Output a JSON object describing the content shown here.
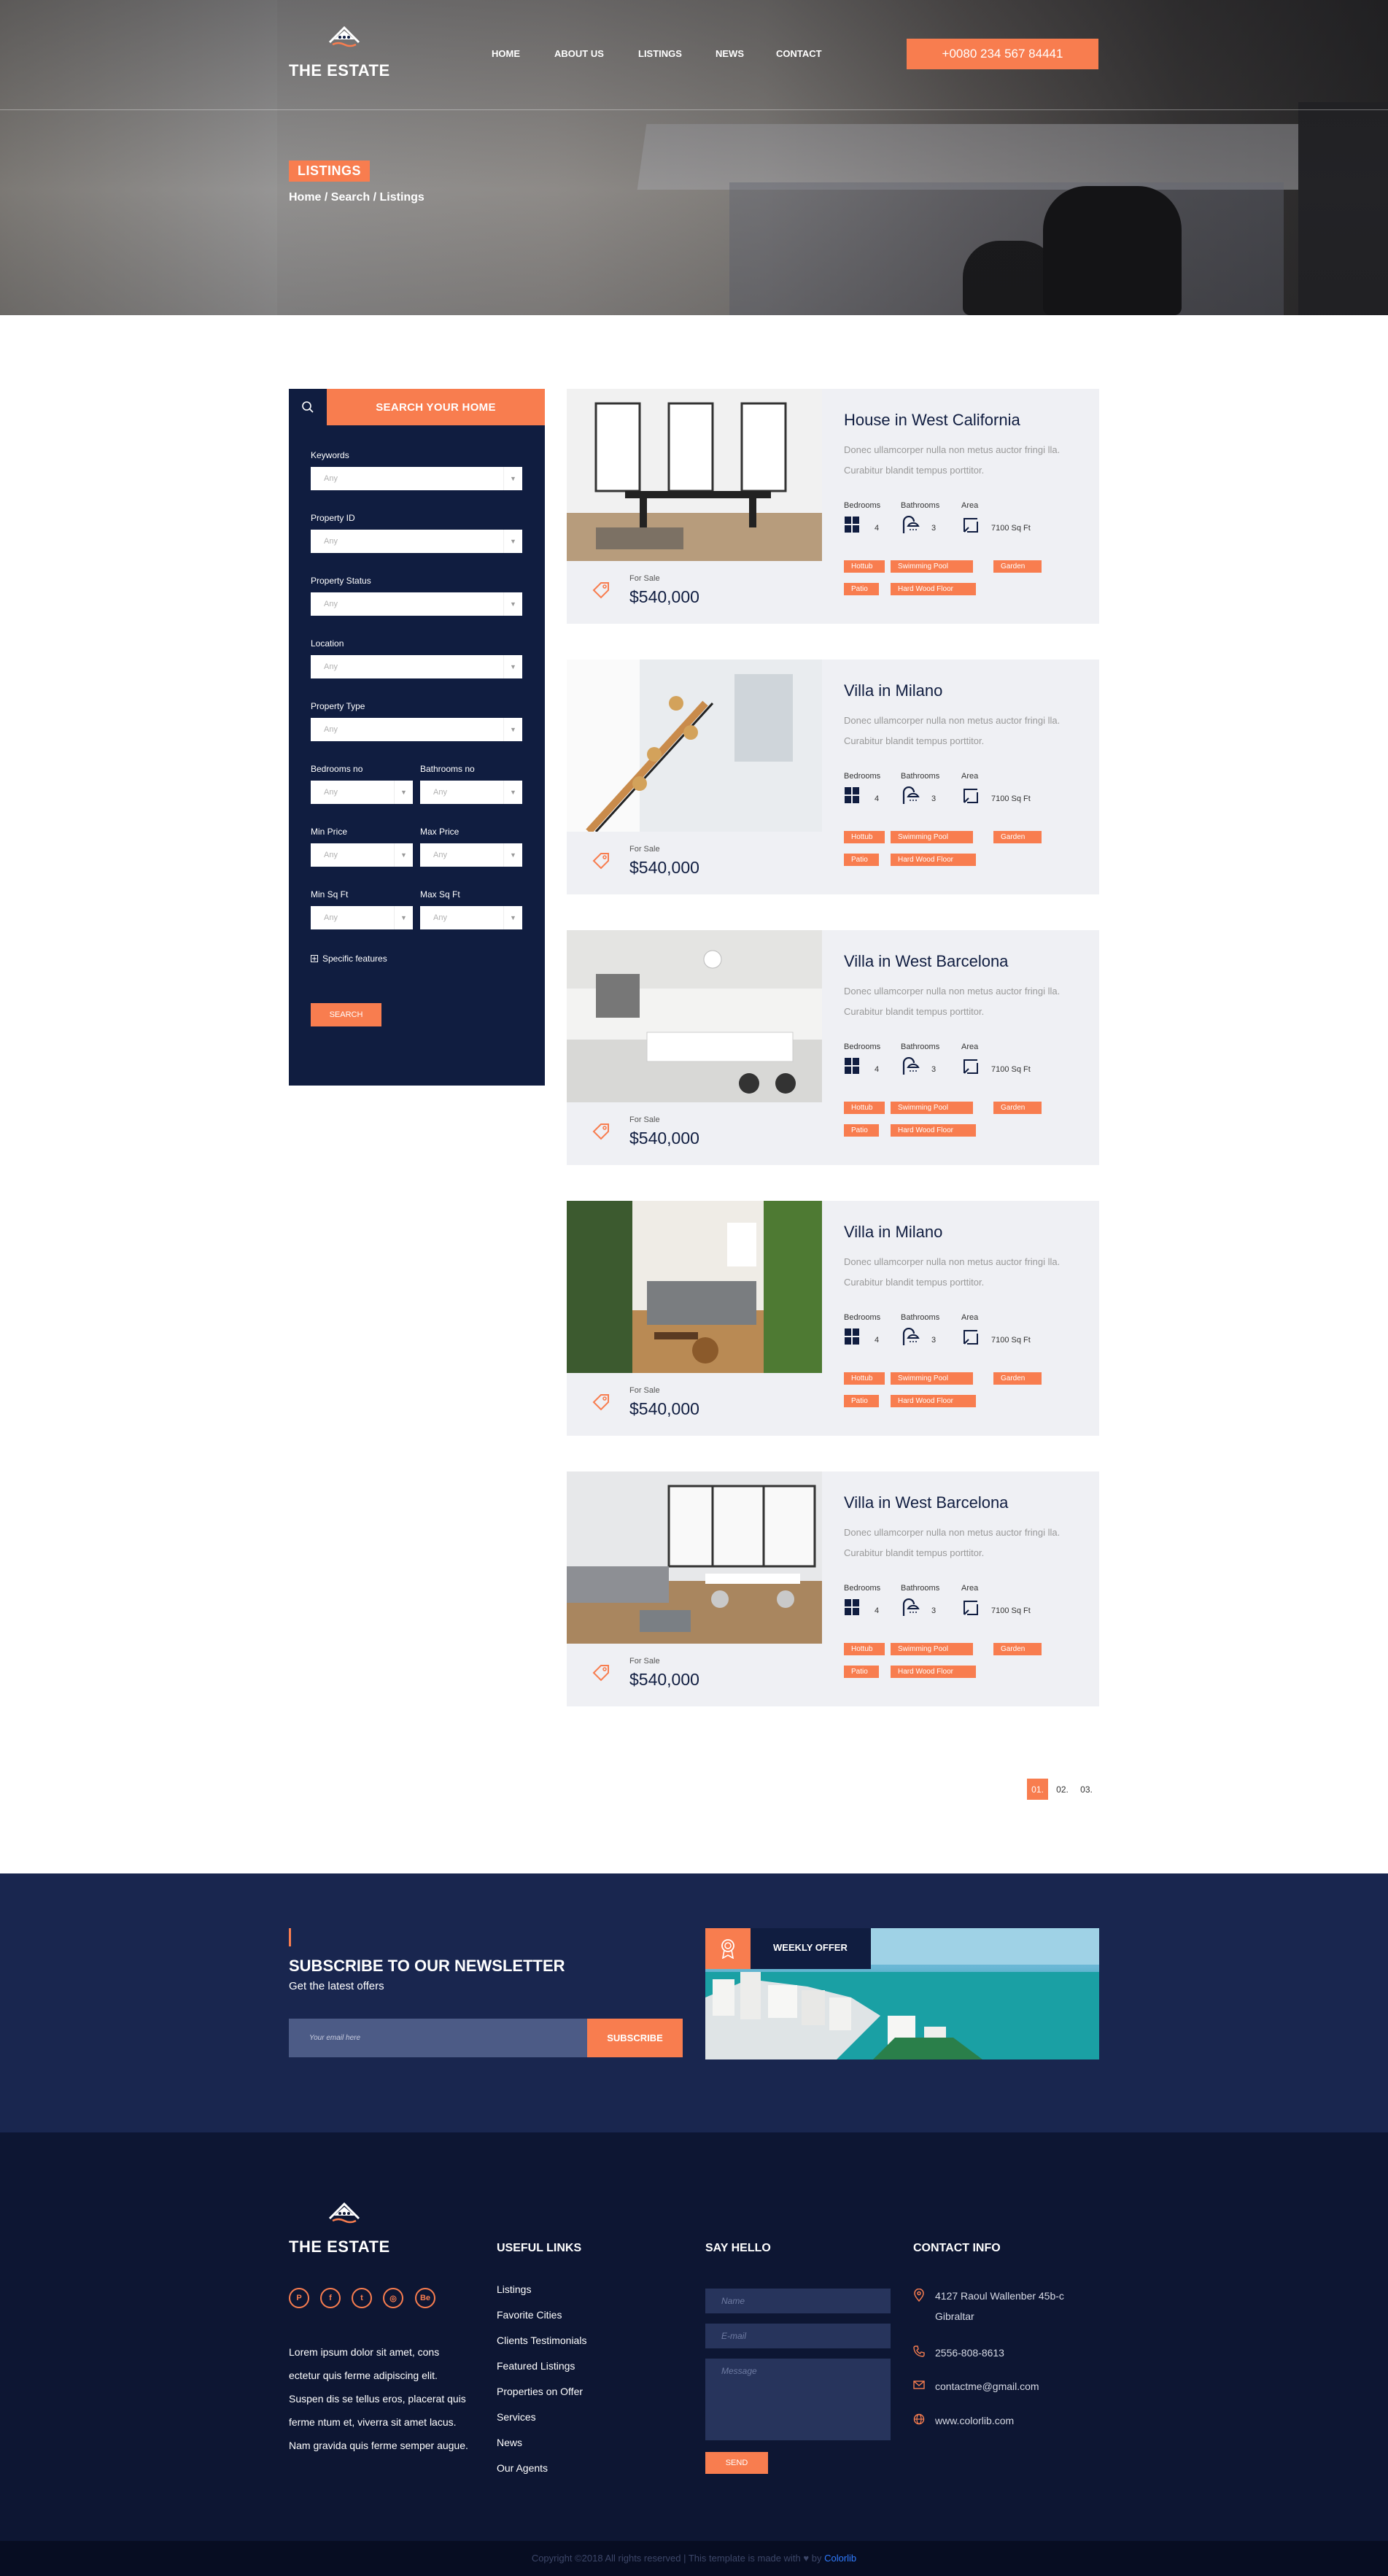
{
  "header": {
    "logo_text": "THE ESTATE",
    "nav": [
      "HOME",
      "ABOUT US",
      "LISTINGS",
      "NEWS",
      "CONTACT"
    ],
    "phone": "+0080 234 567 84441"
  },
  "hero": {
    "page_title": "LISTINGS",
    "breadcrumb": "Home / Search / Listings"
  },
  "search": {
    "title": "SEARCH YOUR HOME",
    "fields": {
      "keywords": {
        "label": "Keywords",
        "value": "Any"
      },
      "property_id": {
        "label": "Property ID",
        "value": "Any"
      },
      "property_status": {
        "label": "Property Status",
        "value": "Any"
      },
      "location": {
        "label": "Location",
        "value": "Any"
      },
      "property_type": {
        "label": "Property Type",
        "value": "Any"
      },
      "bedrooms": {
        "label": "Bedrooms no",
        "value": "Any"
      },
      "bathrooms": {
        "label": "Bathrooms no",
        "value": "Any"
      },
      "min_price": {
        "label": "Min Price",
        "value": "Any"
      },
      "max_price": {
        "label": "Max Price",
        "value": "Any"
      },
      "min_sqft": {
        "label": "Min Sq Ft",
        "value": "Any"
      },
      "max_sqft": {
        "label": "Max Sq Ft",
        "value": "Any"
      }
    },
    "specific_features": "Specific features",
    "button": "SEARCH"
  },
  "listing_labels": {
    "bedrooms": "Bedrooms",
    "bathrooms": "Bathrooms",
    "area": "Area"
  },
  "listings": [
    {
      "title": "House in West California",
      "desc": "Donec ullamcorper nulla non metus auctor fringi lla. Curabitur blandit tempus porttitor.",
      "status": "For Sale",
      "price": "$540,000",
      "bedrooms": "4",
      "bathrooms": "3",
      "area": "7100 Sq Ft",
      "tags": [
        "Hottub",
        "Swimming Pool",
        "Garden",
        "Patio",
        "Hard Wood Floor"
      ]
    },
    {
      "title": "Villa in Milano",
      "desc": "Donec ullamcorper nulla non metus auctor fringi lla. Curabitur blandit tempus porttitor.",
      "status": "For Sale",
      "price": "$540,000",
      "bedrooms": "4",
      "bathrooms": "3",
      "area": "7100 Sq Ft",
      "tags": [
        "Hottub",
        "Swimming Pool",
        "Garden",
        "Patio",
        "Hard Wood Floor"
      ]
    },
    {
      "title": "Villa in West Barcelona",
      "desc": "Donec ullamcorper nulla non metus auctor fringi lla. Curabitur blandit tempus porttitor.",
      "status": "For Sale",
      "price": "$540,000",
      "bedrooms": "4",
      "bathrooms": "3",
      "area": "7100 Sq Ft",
      "tags": [
        "Hottub",
        "Swimming Pool",
        "Garden",
        "Patio",
        "Hard Wood Floor"
      ]
    },
    {
      "title": "Villa in Milano",
      "desc": "Donec ullamcorper nulla non metus auctor fringi lla. Curabitur blandit tempus porttitor.",
      "status": "For Sale",
      "price": "$540,000",
      "bedrooms": "4",
      "bathrooms": "3",
      "area": "7100 Sq Ft",
      "tags": [
        "Hottub",
        "Swimming Pool",
        "Garden",
        "Patio",
        "Hard Wood Floor"
      ]
    },
    {
      "title": "Villa in West Barcelona",
      "desc": "Donec ullamcorper nulla non metus auctor fringi lla. Curabitur blandit tempus porttitor.",
      "status": "For Sale",
      "price": "$540,000",
      "bedrooms": "4",
      "bathrooms": "3",
      "area": "7100 Sq Ft",
      "tags": [
        "Hottub",
        "Swimming Pool",
        "Garden",
        "Patio",
        "Hard Wood Floor"
      ]
    }
  ],
  "pagination": [
    "01.",
    "02.",
    "03."
  ],
  "newsletter": {
    "title": "SUBSCRIBE TO OUR NEWSLETTER",
    "subtitle": "Get the latest offers",
    "placeholder": "Your email here",
    "button": "SUBSCRIBE",
    "offer_label": "WEEKLY OFFER"
  },
  "footer": {
    "logo_text": "THE ESTATE",
    "about": "Lorem ipsum dolor sit amet, cons ectetur quis ferme adipiscing elit. Suspen dis se tellus eros, placerat quis ferme ntum et, viverra sit amet lacus. Nam gravida quis ferme semper augue.",
    "useful_links_title": "USEFUL LINKS",
    "useful_links": [
      "Listings",
      "Favorite Cities",
      "Clients Testimonials",
      "Featured Listings",
      "Properties on Offer",
      "Services",
      "News",
      "Our Agents"
    ],
    "say_hello_title": "SAY HELLO",
    "form": {
      "name": "Name",
      "email": "E-mail",
      "message": "Message",
      "send": "SEND"
    },
    "contact_title": "CONTACT INFO",
    "address": "4127 Raoul Wallenber 45b-c Gibraltar",
    "phone": "2556-808-8613",
    "email": "contactme@gmail.com",
    "website": "www.colorlib.com",
    "copyright": "Copyright ©2018 All rights reserved | This template is made with",
    "copyright_by": "by",
    "copyright_link": "Colorlib"
  },
  "colors": {
    "accent": "#f87d4f",
    "navy": "#101d40",
    "newsletter_bg": "#19264f",
    "footer_bg": "#0d1633"
  }
}
